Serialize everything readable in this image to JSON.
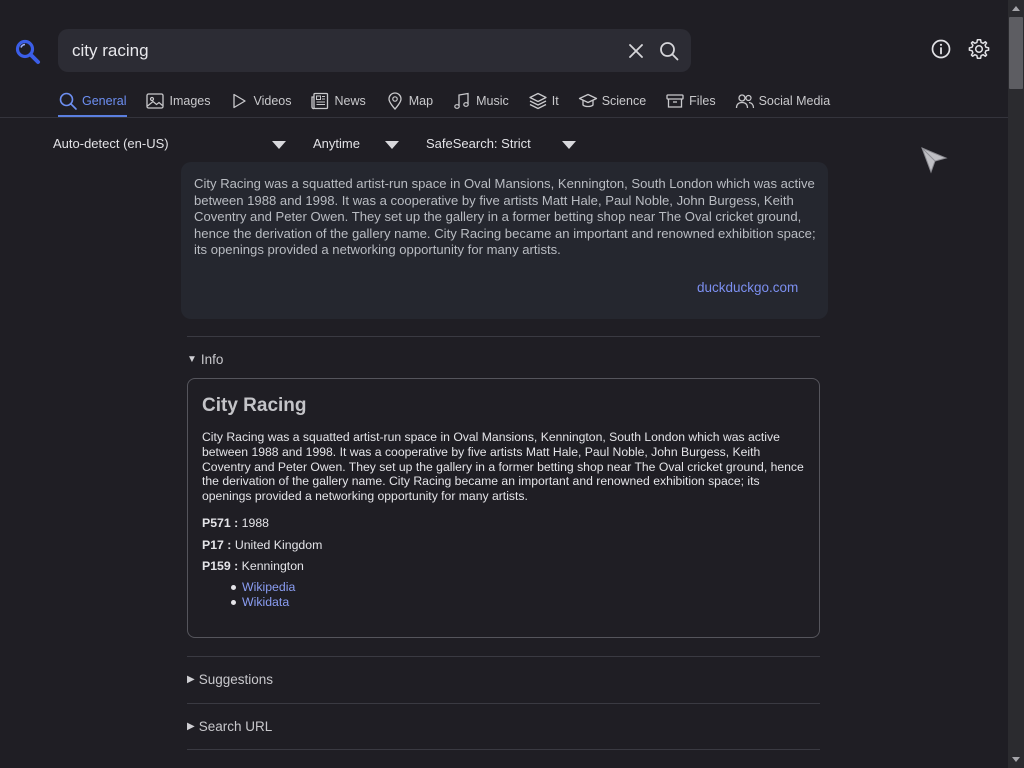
{
  "search": {
    "query": "city racing"
  },
  "icons": {
    "logo": "search-logo-icon",
    "clear": "close-icon",
    "search": "search-icon",
    "about": "info-icon",
    "preferences": "gear-icon",
    "cursor": "mouse-pointer-icon"
  },
  "tabs": [
    {
      "label": "General",
      "icon": "search-icon",
      "active": true
    },
    {
      "label": "Images",
      "icon": "image-icon"
    },
    {
      "label": "Videos",
      "icon": "play-icon"
    },
    {
      "label": "News",
      "icon": "newspaper-icon"
    },
    {
      "label": "Map",
      "icon": "map-pin-icon"
    },
    {
      "label": "Music",
      "icon": "music-icon"
    },
    {
      "label": "It",
      "icon": "layers-icon"
    },
    {
      "label": "Science",
      "icon": "graduation-cap-icon"
    },
    {
      "label": "Files",
      "icon": "archive-icon"
    },
    {
      "label": "Social Media",
      "icon": "users-icon"
    }
  ],
  "filters": {
    "language": "Auto-detect (en-US)",
    "time": "Anytime",
    "safesearch": "SafeSearch: Strict"
  },
  "answer": {
    "text": "City Racing was a squatted artist-run space in Oval Mansions, Kennington, South London which was active between 1988 and 1998. It was a cooperative by five artists Matt Hale, Paul Noble, John Burgess, Keith Coventry and Peter Owen. They set up the gallery in a former betting shop near The Oval cricket ground, hence the derivation of the gallery name. City Racing became an important and renowned exhibition space; its openings provided a networking opportunity for many artists.",
    "source": "duckduckgo.com"
  },
  "sections": {
    "info": "Info",
    "suggestions": "Suggestions",
    "search_url": "Search URL"
  },
  "infobox": {
    "title": "City Racing",
    "text": "City Racing was a squatted artist-run space in Oval Mansions, Kennington, South London which was active between 1988 and 1998. It was a cooperative by five artists Matt Hale, Paul Noble, John Burgess, Keith Coventry and Peter Owen. They set up the gallery in a former betting shop near The Oval cricket ground, hence the derivation of the gallery name. City Racing became an important and renowned exhibition space; its openings provided a networking opportunity for many artists.",
    "attributes": [
      {
        "key": "P571 :",
        "value": "1988"
      },
      {
        "key": "P17 :",
        "value": "United Kingdom"
      },
      {
        "key": "P159 :",
        "value": "Kennington"
      }
    ],
    "links": [
      "Wikipedia",
      "Wikidata"
    ]
  },
  "colors": {
    "background": "#1f1e24",
    "accent": "#6d8ff2",
    "link": "#8a9df2"
  }
}
